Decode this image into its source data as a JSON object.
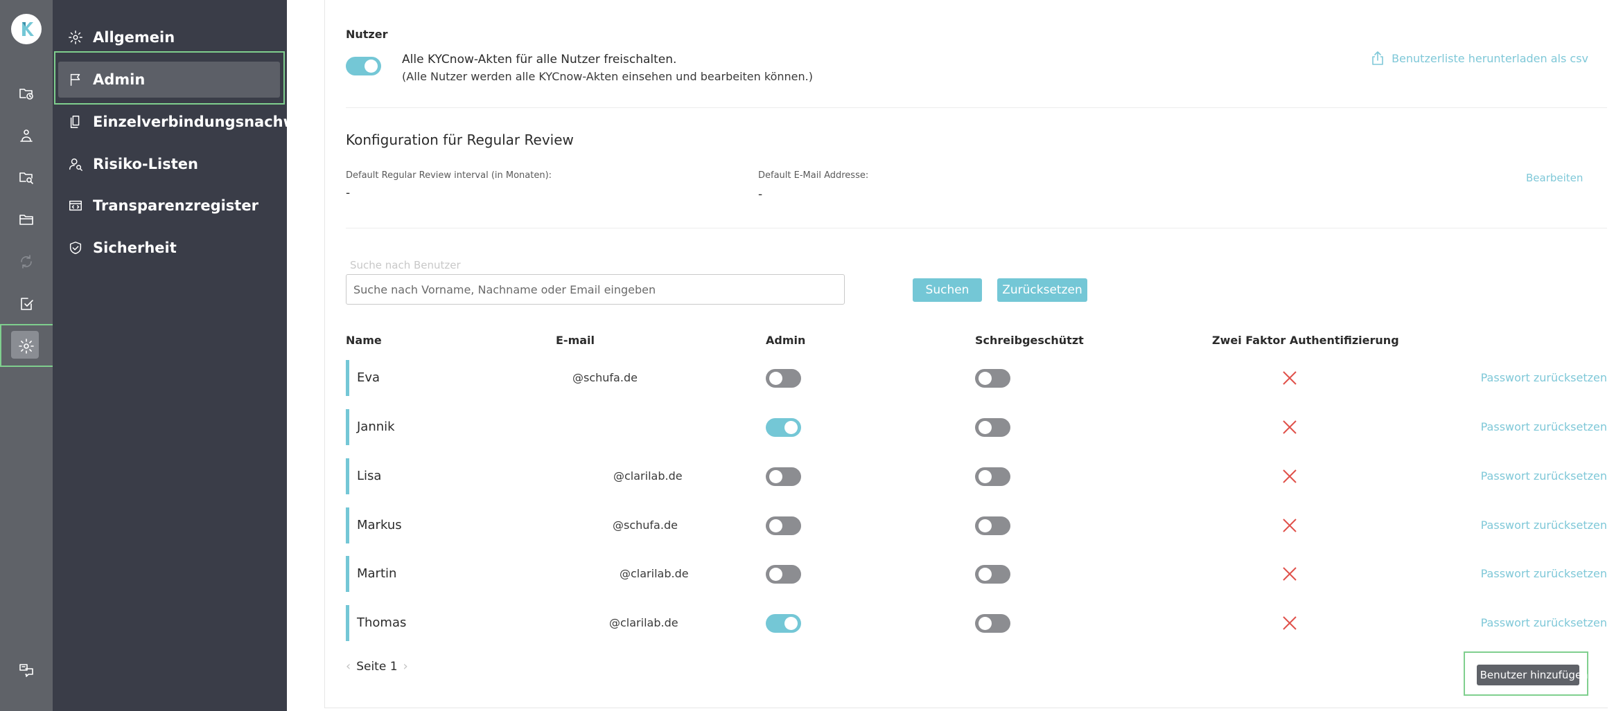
{
  "sidebar": {
    "items": [
      {
        "label": "Allgemein",
        "icon": "gear-icon"
      },
      {
        "label": "Admin",
        "icon": "flag-icon"
      },
      {
        "label": "Einzelverbindungsnachweise",
        "icon": "documents-icon"
      },
      {
        "label": "Risiko-Listen",
        "icon": "user-search-icon"
      },
      {
        "label": "Transparenzregister",
        "icon": "code-window-icon"
      },
      {
        "label": "Sicherheit",
        "icon": "shield-check-icon"
      }
    ],
    "active": "Admin"
  },
  "rail": {
    "icons": [
      "logo-icon",
      "folder-clock-icon",
      "person-network-icon",
      "folder-search-icon",
      "folder-icon",
      "refresh-icon",
      "document-check-icon",
      "settings-icon",
      "translate-icon"
    ]
  },
  "nutzer": {
    "section_label": "Nutzer",
    "toggle_on": true,
    "main_text": "Alle KYCnow-Akten für alle Nutzer freischalten.",
    "sub_text": "(Alle Nutzer werden alle KYCnow-Akten einsehen und bearbeiten können.)",
    "download_link": "Benutzerliste herunterladen als csv"
  },
  "review": {
    "heading": "Konfiguration für Regular Review",
    "interval_label": "Default Regular Review interval (in Monaten):",
    "interval_value": "-",
    "email_label": "Default E-Mail Addresse:",
    "email_value": "-",
    "edit_link": "Bearbeiten"
  },
  "search": {
    "label": "Suche nach Benutzer",
    "placeholder": "Suche nach Vorname, Nachname oder Email eingeben",
    "value": "",
    "search_button": "Suchen",
    "reset_button": "Zurücksetzen"
  },
  "table": {
    "headers": {
      "name": "Name",
      "email": "E-mail",
      "admin": "Admin",
      "readonly": "Schreibgeschützt",
      "twofa": "Zwei Faktor Authentifizierung"
    },
    "rows": [
      {
        "name": "Eva",
        "email": "@schufa.de",
        "admin": false,
        "readonly": false,
        "twofa": false,
        "action": "Passwort zurücksetzen"
      },
      {
        "name": "Jannik",
        "email": "",
        "admin": true,
        "readonly": false,
        "twofa": false,
        "action": "Passwort zurücksetzen"
      },
      {
        "name": "Lisa",
        "email": "@clarilab.de",
        "admin": false,
        "readonly": false,
        "twofa": false,
        "action": "Passwort zurücksetzen"
      },
      {
        "name": "Markus",
        "email": "@schufa.de",
        "admin": false,
        "readonly": false,
        "twofa": false,
        "action": "Passwort zurücksetzen"
      },
      {
        "name": "Martin",
        "email": "@clarilab.de",
        "admin": false,
        "readonly": false,
        "twofa": false,
        "action": "Passwort zurücksetzen"
      },
      {
        "name": "Thomas",
        "email": "@clarilab.de",
        "admin": true,
        "readonly": false,
        "twofa": false,
        "action": "Passwort zurücksetzen"
      }
    ]
  },
  "pagination": {
    "label": "Seite 1"
  },
  "add_user_button": "+ Benutzer hinzufügen",
  "colors": {
    "accent": "#74c7d6",
    "sidebar_dark": "#3a3d48",
    "rail": "#5f6268",
    "highlight": "#7fcf8e",
    "error": "#e0504a"
  }
}
